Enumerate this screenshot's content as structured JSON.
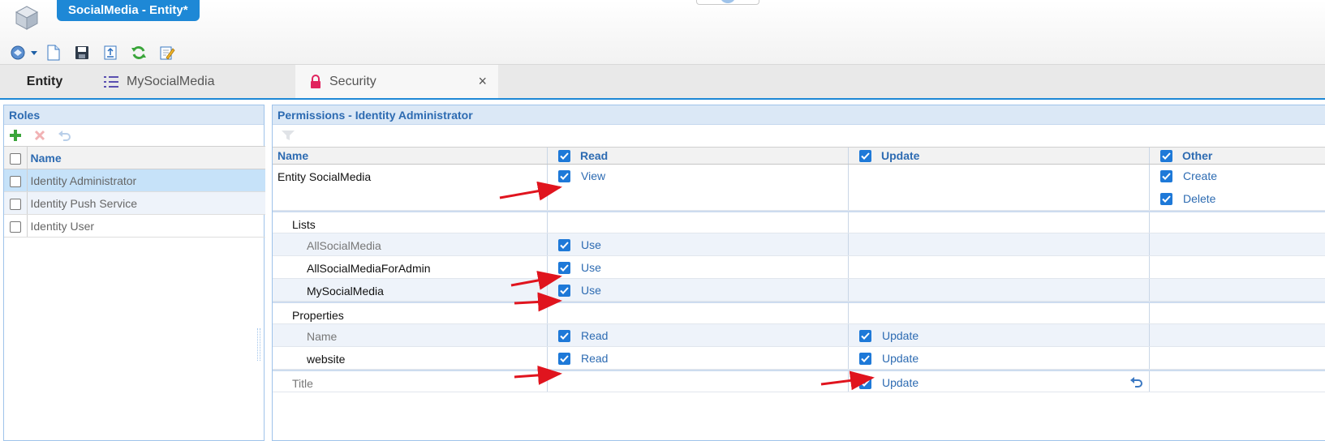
{
  "window": {
    "title": "SocialMedia - Entity*"
  },
  "tabs": [
    {
      "label": "Entity"
    },
    {
      "label": "MySocialMedia"
    },
    {
      "label": "Security",
      "close": "×"
    }
  ],
  "roles": {
    "title": "Roles",
    "column_name": "Name",
    "items": [
      {
        "name": "Identity Administrator",
        "selected": true
      },
      {
        "name": "Identity Push Service",
        "selected": false
      },
      {
        "name": "Identity User",
        "selected": false
      }
    ]
  },
  "permissions": {
    "title": "Permissions - Identity Administrator",
    "columns": {
      "name": "Name",
      "read": "Read",
      "update": "Update",
      "other": "Other"
    },
    "entity_row": {
      "name": "Entity SocialMedia",
      "read": "View",
      "other": [
        "Create",
        "Delete"
      ]
    },
    "lists_section": {
      "label": "Lists"
    },
    "lists": [
      {
        "name": "AllSocialMedia",
        "read": "Use"
      },
      {
        "name": "AllSocialMediaForAdmin",
        "read": "Use"
      },
      {
        "name": "MySocialMedia",
        "read": "Use"
      }
    ],
    "properties_section": {
      "label": "Properties"
    },
    "properties": [
      {
        "name": "Name",
        "read": "Read",
        "update": "Update"
      },
      {
        "name": "website",
        "read": "Read",
        "update": "Update"
      },
      {
        "name": "Title",
        "read": "",
        "update": "Update"
      }
    ]
  },
  "colors": {
    "accent": "#1e88d6",
    "checkbox": "#1e79d8",
    "header_text": "#2d6bb2",
    "annotation_arrow": "#e0141e"
  },
  "icons": [
    "app-cube-icon",
    "dropdown-icon",
    "new-document-icon",
    "save-icon",
    "export-icon",
    "refresh-icon",
    "edit-icon",
    "list-icon",
    "lock-icon",
    "close-icon",
    "add-icon",
    "delete-icon",
    "undo-icon",
    "filter-icon"
  ]
}
